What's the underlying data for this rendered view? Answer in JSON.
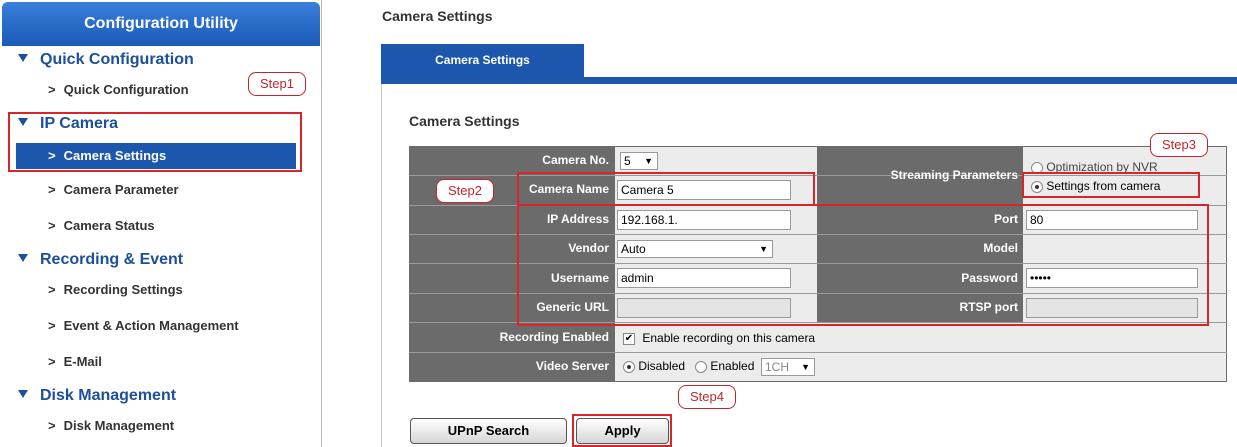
{
  "sidebar": {
    "title": "Configuration Utility",
    "sections": [
      {
        "label": "Quick Configuration",
        "items": [
          "Quick Configuration"
        ]
      },
      {
        "label": "IP Camera",
        "items": [
          "Camera Settings",
          "Camera Parameter",
          "Camera Status"
        ]
      },
      {
        "label": "Recording & Event",
        "items": [
          "Recording Settings",
          "Event & Action Management",
          "E-Mail"
        ]
      },
      {
        "label": "Disk Management",
        "items": [
          "Disk Management"
        ]
      }
    ],
    "marker": ">"
  },
  "page_title": "Camera Settings",
  "tab_label": "Camera Settings",
  "box_title": "Camera Settings",
  "form": {
    "camera_no_label": "Camera No.",
    "camera_no_value": "5",
    "camera_name_label": "Camera Name",
    "camera_name_value": "Camera 5",
    "ip_label": "IP Address",
    "ip_value": "192.168.1.",
    "vendor_label": "Vendor",
    "vendor_value": "Auto",
    "username_label": "Username",
    "username_value": "admin",
    "generic_url_label": "Generic URL",
    "generic_url_value": "",
    "recording_label": "Recording Enabled",
    "recording_checkbox_label": "Enable recording on this camera",
    "video_server_label": "Video Server",
    "video_disabled_label": "Disabled",
    "video_enabled_label": "Enabled",
    "video_channel_value": "1CH",
    "streaming_label": "Streaming Parameters",
    "streaming_option1": "Optimization by NVR",
    "streaming_option2": "Settings from camera",
    "port_label": "Port",
    "port_value": "80",
    "model_label": "Model",
    "password_label": "Password",
    "password_value": "•••••",
    "rtsp_label": "RTSP port",
    "rtsp_value": ""
  },
  "buttons": {
    "upnp": "UPnP Search",
    "apply": "Apply"
  },
  "callouts": {
    "step1": "Step1",
    "step2": "Step2",
    "step3": "Step3",
    "step4": "Step4"
  },
  "colors": {
    "brand_blue": "#1c57ad",
    "annotation_red": "#d9242a",
    "form_gray": "#6b6b6b"
  }
}
